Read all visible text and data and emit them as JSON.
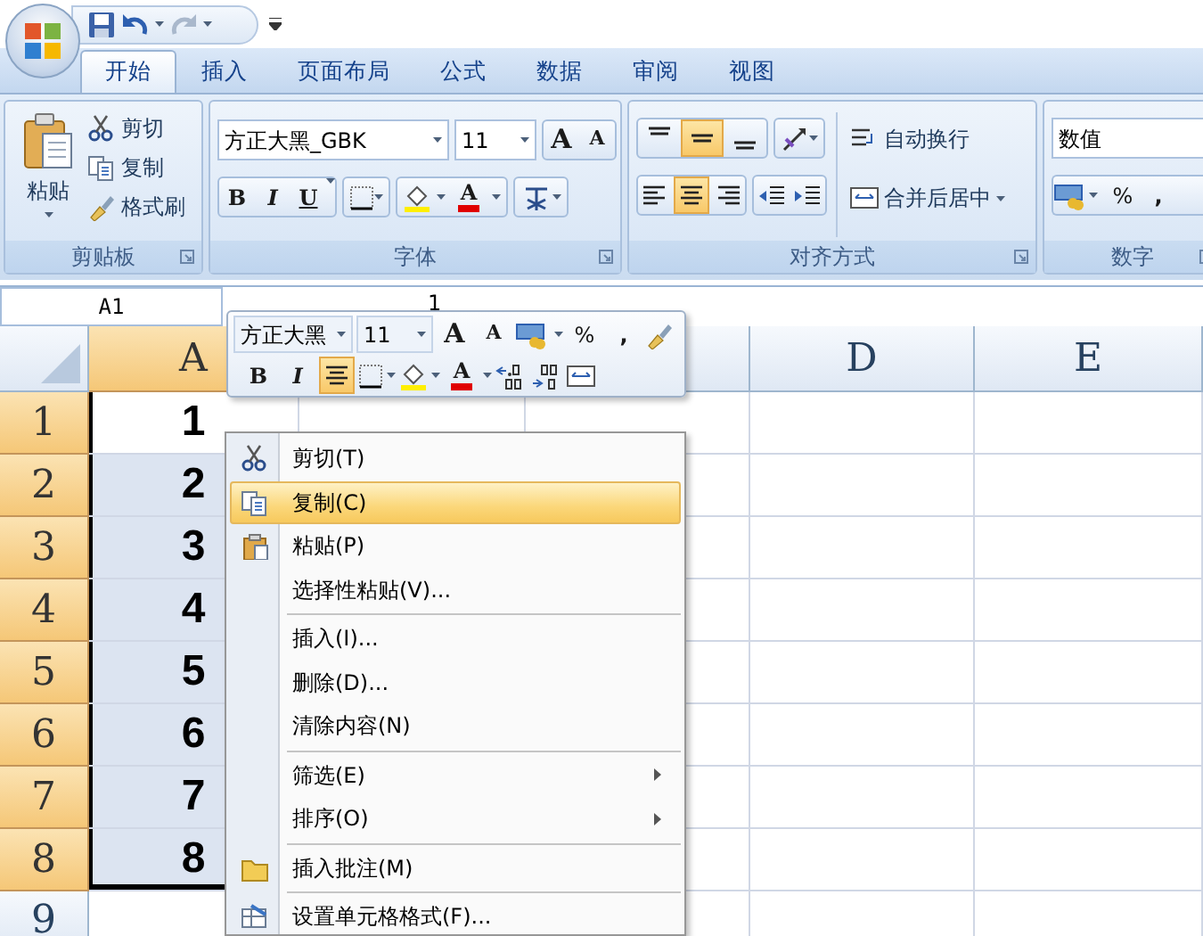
{
  "tabs": [
    {
      "label": "开始",
      "selected": true
    },
    {
      "label": "插入",
      "selected": false
    },
    {
      "label": "页面布局",
      "selected": false
    },
    {
      "label": "公式",
      "selected": false
    },
    {
      "label": "数据",
      "selected": false
    },
    {
      "label": "审阅",
      "selected": false
    },
    {
      "label": "视图",
      "selected": false
    }
  ],
  "ribbon": {
    "clipboard": {
      "title": "剪贴板",
      "paste": "粘贴",
      "commands": [
        "剪切",
        "复制",
        "格式刷"
      ]
    },
    "font": {
      "title": "字体",
      "font_name": "方正大黑_GBK",
      "font_size": "11",
      "grow": "A",
      "shrink": "A",
      "bold": "B",
      "italic": "I",
      "underline": "U",
      "font_color": "A"
    },
    "alignment": {
      "title": "对齐方式",
      "vertical": [
        {
          "kind": "top",
          "selected": false
        },
        {
          "kind": "middle",
          "selected": true
        },
        {
          "kind": "bottom",
          "selected": false
        }
      ],
      "horizontal": [
        {
          "kind": "left",
          "selected": false
        },
        {
          "kind": "center",
          "selected": true
        },
        {
          "kind": "right",
          "selected": false
        }
      ],
      "wrap_text": "自动换行",
      "merge_center": "合并后居中"
    },
    "number": {
      "title": "数字",
      "format": "数值",
      "percent": "%",
      "comma": ","
    }
  },
  "formula_bar": {
    "name_box": "A1",
    "value": "1"
  },
  "columns": [
    {
      "label": "A",
      "selected": true
    },
    {},
    {
      "selected": false
    },
    {
      "label": "D",
      "selected": false
    },
    {
      "label": "E",
      "selected": false
    }
  ],
  "rows": [
    {
      "header": "1",
      "selected": true,
      "active": true,
      "value": "1"
    },
    {
      "header": "2",
      "selected": true,
      "active": false,
      "value": "2"
    },
    {
      "header": "3",
      "selected": true,
      "active": false,
      "value": "3"
    },
    {
      "header": "4",
      "selected": true,
      "active": false,
      "value": "4"
    },
    {
      "header": "5",
      "selected": true,
      "active": false,
      "value": "5"
    },
    {
      "header": "6",
      "selected": true,
      "active": false,
      "value": "6"
    },
    {
      "header": "7",
      "selected": true,
      "active": false,
      "value": "7"
    },
    {
      "header": "8",
      "selected": true,
      "active": false,
      "value": "8"
    },
    {
      "header": "9",
      "selected": false,
      "active": false
    }
  ],
  "mini_toolbar": {
    "font_name": "方正大黑",
    "font_size": "11",
    "grow": "A",
    "shrink": "A",
    "percent": "%",
    "comma": ",",
    "bold": "B",
    "italic": "I",
    "center_selected": true,
    "font_color": "A"
  },
  "context_menu": {
    "sections": [
      [
        {
          "label": "剪切(T)",
          "highlighted": false,
          "submenu": false
        },
        {
          "label": "复制(C)",
          "highlighted": true,
          "submenu": false
        },
        {
          "label": "粘贴(P)",
          "highlighted": false,
          "submenu": false
        },
        {
          "label": "选择性粘贴(V)...",
          "highlighted": false,
          "submenu": false
        }
      ],
      [
        {
          "label": "插入(I)...",
          "highlighted": false,
          "submenu": false
        },
        {
          "label": "删除(D)...",
          "highlighted": false,
          "submenu": false
        },
        {
          "label": "清除内容(N)",
          "highlighted": false,
          "submenu": false
        }
      ],
      [
        {
          "label": "筛选(E)",
          "highlighted": false,
          "submenu": true
        },
        {
          "label": "排序(O)",
          "highlighted": false,
          "submenu": true
        }
      ],
      [
        {
          "label": "插入批注(M)",
          "highlighted": false,
          "submenu": false
        }
      ],
      [
        {
          "label": "设置单元格格式(F)...",
          "highlighted": false,
          "submenu": false
        }
      ]
    ]
  }
}
